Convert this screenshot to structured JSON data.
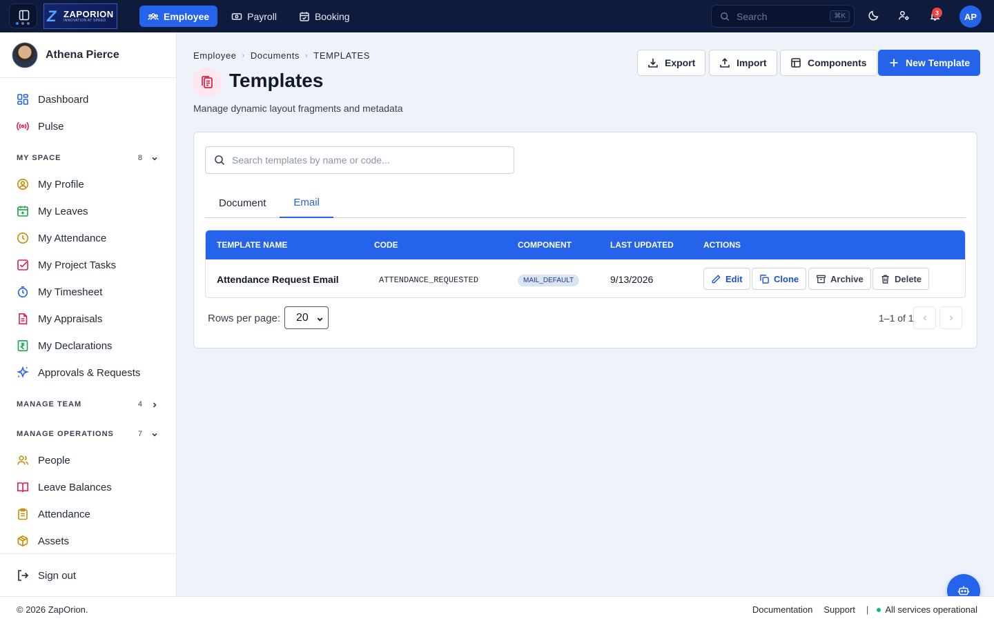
{
  "topbar": {
    "logo_name": "ZAPORION",
    "logo_tagline": "INNOVATION AT SPEED",
    "nav": [
      {
        "label": "Employee"
      },
      {
        "label": "Payroll"
      },
      {
        "label": "Booking"
      }
    ],
    "search_placeholder": "Search",
    "search_shortcut": "⌘K",
    "notification_count": "3",
    "avatar_initials": "AP"
  },
  "sidebar": {
    "user_name": "Athena Pierce",
    "top_items": [
      {
        "label": "Dashboard",
        "icon": "dashboard-icon"
      },
      {
        "label": "Pulse",
        "icon": "pulse-icon"
      }
    ],
    "my_space": {
      "title": "MY SPACE",
      "count": "8",
      "items": [
        {
          "label": "My Profile",
          "icon": "profile-icon"
        },
        {
          "label": "My Leaves",
          "icon": "calendar-icon"
        },
        {
          "label": "My Attendance",
          "icon": "clock-icon"
        },
        {
          "label": "My Project Tasks",
          "icon": "task-icon"
        },
        {
          "label": "My Timesheet",
          "icon": "timer-icon"
        },
        {
          "label": "My Appraisals",
          "icon": "document-icon"
        },
        {
          "label": "My Declarations",
          "icon": "rupee-icon"
        },
        {
          "label": "Approvals & Requests",
          "icon": "sparkle-icon"
        }
      ]
    },
    "manage_team": {
      "title": "MANAGE TEAM",
      "count": "4"
    },
    "manage_operations": {
      "title": "MANAGE OPERATIONS",
      "count": "7",
      "items": [
        {
          "label": "People",
          "icon": "people-icon"
        },
        {
          "label": "Leave Balances",
          "icon": "book-icon"
        },
        {
          "label": "Attendance",
          "icon": "clipboard-icon"
        },
        {
          "label": "Assets",
          "icon": "box-icon"
        }
      ]
    },
    "sign_out": "Sign out"
  },
  "main": {
    "breadcrumb": [
      "Employee",
      "Documents",
      "TEMPLATES"
    ],
    "title": "Templates",
    "subtitle": "Manage dynamic layout fragments and metadata",
    "actions": {
      "export": "Export",
      "import": "Import",
      "components": "Components",
      "new_template": "New Template"
    },
    "search_placeholder": "Search templates by name or code...",
    "tabs": [
      {
        "label": "Document",
        "active": false
      },
      {
        "label": "Email",
        "active": true
      }
    ],
    "table": {
      "columns": [
        "TEMPLATE NAME",
        "CODE",
        "COMPONENT",
        "LAST UPDATED",
        "ACTIONS"
      ],
      "rows": [
        {
          "name": "Attendance Request Email",
          "code": "ATTENDANCE_REQUESTED",
          "component": "MAIL_DEFAULT",
          "last_updated": "9/13/2026",
          "actions": {
            "edit": "Edit",
            "clone": "Clone",
            "archive": "Archive",
            "delete": "Delete"
          }
        }
      ]
    },
    "pagination": {
      "rows_per_page_label": "Rows per page:",
      "rows_per_page": "20",
      "range": "1–1 of 1"
    }
  },
  "footer": {
    "copyright": "© 2026 ZapOrion.",
    "documentation": "Documentation",
    "support": "Support",
    "status": "All services operational"
  },
  "colors": {
    "topbar_bg": "#0f1b3d",
    "primary": "#2563eb",
    "page_bg": "#eef2fa",
    "status_ok": "#10b981",
    "notification": "#ef4444"
  }
}
